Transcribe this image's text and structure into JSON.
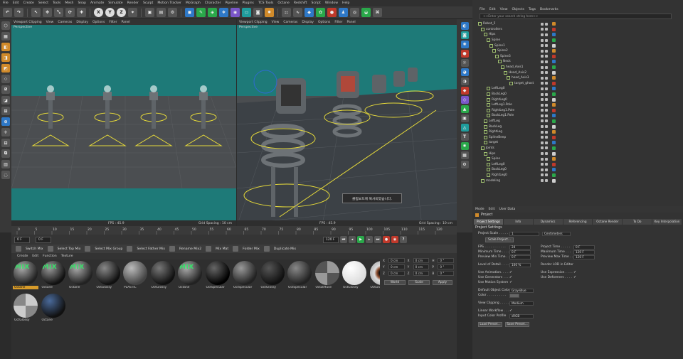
{
  "menubar": [
    "File",
    "Edit",
    "Create",
    "Select",
    "Tools",
    "Mesh",
    "Snap",
    "Animate",
    "Simulate",
    "Render",
    "Sculpt",
    "Motion Tracker",
    "MoGraph",
    "Character",
    "Pipeline",
    "Plugins",
    "TCS Tools",
    "Octane",
    "Redshift",
    "Script",
    "Window",
    "Help"
  ],
  "toolbar": {
    "x": "X",
    "y": "Y",
    "z": "Z"
  },
  "viewport_left": {
    "menu": [
      "Viewport Clipping",
      "View",
      "Cameras",
      "Display",
      "Options",
      "Filter",
      "Panel"
    ],
    "label": "Perspective",
    "fps": "FPS : 45.9",
    "grid": "Grid Spacing : 10 cm"
  },
  "viewport_right": {
    "tab": "View",
    "menu": [
      "Viewport Clipping",
      "View",
      "Cameras",
      "Display",
      "Options",
      "Filter",
      "Panel"
    ],
    "label": "Perspective",
    "fps": "FPS : 45.9",
    "grid": "Grid Spacing : 10 cm"
  },
  "popup_text": "클립보드에 복사되었습니다.",
  "timeline": {
    "ticks": [
      "0",
      "5",
      "10",
      "15",
      "20",
      "25",
      "30",
      "35",
      "40",
      "45",
      "50",
      "55",
      "60",
      "65",
      "70",
      "75",
      "80",
      "85",
      "90",
      "95",
      "100",
      "105",
      "110",
      "115",
      "120"
    ],
    "frame_end": "0 F"
  },
  "transport": {
    "start": "0 F",
    "current": "0 F",
    "end": "120 F",
    "max": "120 F"
  },
  "mixbar": [
    "Switch Mix",
    "Select Top Mix",
    "Select Mix Group",
    "Select Father Mix",
    "Rename Mix2",
    "Mix Mat",
    "Folder Mix",
    "Duplicate Mix"
  ],
  "material_menu": [
    "Create",
    "Edit",
    "Function",
    "Texture"
  ],
  "materials": [
    {
      "name": "Octane",
      "mix": "MIX",
      "selected": true
    },
    {
      "name": "Octane",
      "mix": "MIX"
    },
    {
      "name": "Octane",
      "mix": "MIX"
    },
    {
      "name": "OctGlossy"
    },
    {
      "name": "PLASTIC"
    },
    {
      "name": "OctGlossy"
    },
    {
      "name": "Octane",
      "mix": "MIX"
    },
    {
      "name": "OctSpecular"
    },
    {
      "name": "OctSpecular"
    },
    {
      "name": "OctGlossy"
    },
    {
      "name": "OctSpecular"
    },
    {
      "name": "OctDiffuse"
    },
    {
      "name": "OctGlossy"
    },
    {
      "name": "OctGlossy"
    },
    {
      "name": "OctGlossy"
    },
    {
      "name": "Octane"
    }
  ],
  "coords": {
    "rows": [
      {
        "a": "X",
        "av": "0 cm",
        "b": "X",
        "bv": "0 cm",
        "c": "H",
        "cv": "0 °"
      },
      {
        "a": "Y",
        "av": "0 cm",
        "b": "Y",
        "bv": "0 cm",
        "c": "P",
        "cv": "0 °"
      },
      {
        "a": "Z",
        "av": "0 cm",
        "b": "Z",
        "bv": "0 cm",
        "c": "B",
        "cv": "0 °"
      }
    ],
    "mode": "World",
    "scale": "Scale",
    "apply": "Apply"
  },
  "objmgr": {
    "top_menu": [
      "File",
      "Edit",
      "View",
      "Objects",
      "Tags",
      "Bookmarks"
    ],
    "search": "<<Enter your search string here>>",
    "rows": [
      {
        "name": "Robot_5",
        "indent": 0
      },
      {
        "name": "controllers",
        "indent": 1
      },
      {
        "name": "Hips",
        "indent": 2
      },
      {
        "name": "Spine",
        "indent": 3
      },
      {
        "name": "Spine1",
        "indent": 4
      },
      {
        "name": "Spine2",
        "indent": 5
      },
      {
        "name": "Spine3",
        "indent": 6
      },
      {
        "name": "Neck",
        "indent": 7
      },
      {
        "name": "head_Axis1",
        "indent": 8
      },
      {
        "name": "Head_Axis2",
        "indent": 9
      },
      {
        "name": "head_Axis3",
        "indent": 10
      },
      {
        "name": "target_ghost",
        "indent": 11
      },
      {
        "name": "LeftLeg0",
        "indent": 3
      },
      {
        "name": "BackLeg0",
        "indent": 3
      },
      {
        "name": "RightLeg0",
        "indent": 3
      },
      {
        "name": "LeftLeg1.Pole",
        "indent": 3
      },
      {
        "name": "RightLeg1.Pole",
        "indent": 3
      },
      {
        "name": "BackLeg1.Pole",
        "indent": 3
      },
      {
        "name": "LeftLeg",
        "indent": 2
      },
      {
        "name": "BackLeg",
        "indent": 2
      },
      {
        "name": "RightLeg",
        "indent": 2
      },
      {
        "name": "SplineBeep",
        "indent": 2
      },
      {
        "name": "target",
        "indent": 2
      },
      {
        "name": "Joints",
        "indent": 1
      },
      {
        "name": "Hips",
        "indent": 2
      },
      {
        "name": "Spine",
        "indent": 3
      },
      {
        "name": "LeftLeg0",
        "indent": 3
      },
      {
        "name": "BackLeg0",
        "indent": 3
      },
      {
        "name": "RightLeg0",
        "indent": 3
      },
      {
        "name": "modeling",
        "indent": 1
      }
    ]
  },
  "attrmgr": {
    "menu": [
      "Mode",
      "Edit",
      "User Data"
    ],
    "title": "Project",
    "tabs": [
      "Project Settings",
      "Info",
      "Dynamics",
      "Referencing",
      "Octane Render",
      "To Do",
      "Key Interpolation"
    ],
    "section": "Project Settings",
    "project_scale_label": "Project Scale . . . . .",
    "project_scale_value": "1",
    "project_scale_unit": "Centimeters",
    "scale_project_btn": "Scale Project...",
    "fps_label": "FPS . . . . . . . . . . .",
    "fps_value": "24",
    "project_time_label": "Project Time . . . . .",
    "project_time_value": "0 F",
    "min_time_label": "Minimum Time . . . .",
    "min_time_value": "0 F",
    "max_time_label": "Maximum Time . . .",
    "max_time_value": "120 F",
    "prev_min_label": "Preview Min Time . .",
    "prev_min_value": "0 F",
    "prev_max_label": "Preview Max Time . .",
    "prev_max_value": "120 F",
    "lod_label": "Level of Detail . . . .",
    "lod_value": "100 %",
    "render_lod_label": "Render LOD in Editor",
    "use_anim_label": "Use Animation. . . . .",
    "use_expr_label": "Use Expression . . . .",
    "use_gen_label": "Use Generators . . . .",
    "use_def_label": "Use Deformers . . . .",
    "use_motion_label": "Use Motion System",
    "check": "✓",
    "default_color_label": "Default Object Color",
    "default_color_value": "Gray-Blue",
    "color_label": "Color . . . . . . . . . .",
    "view_clip_label": "View Clipping . . . . .",
    "view_clip_value": "Medium",
    "linear_label": "Linear Workflow . . .",
    "input_profile_label": "Input Color Profile",
    "input_profile_value": "sRGB",
    "load_preset": "Load Preset...",
    "save_preset": "Save Preset..."
  },
  "colors": {
    "accent": "#d79b2a",
    "teal": "#1e7a78",
    "mix_green": "#39e06a"
  }
}
